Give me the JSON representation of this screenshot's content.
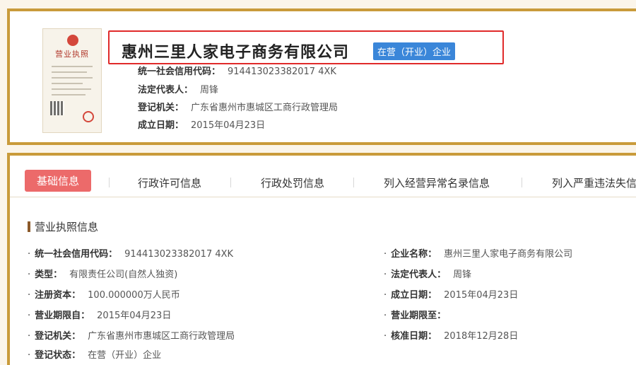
{
  "header": {
    "company_name": "惠州三里人家电子商务有限公司",
    "status_tag": "在营（开业）企业",
    "license_thumb_title": "营业执照",
    "rows": [
      {
        "label": "统一社会信用代码：",
        "value": "914413023382017 4XK"
      },
      {
        "label": "法定代表人：",
        "value": "周锋"
      },
      {
        "label": "登记机关：",
        "value": "广东省惠州市惠城区工商行政管理局"
      },
      {
        "label": "成立日期：",
        "value": "2015年04月23日"
      }
    ]
  },
  "tabs": [
    {
      "label": "基础信息",
      "active": true
    },
    {
      "label": "行政许可信息",
      "active": false
    },
    {
      "label": "行政处罚信息",
      "active": false
    },
    {
      "label": "列入经营异常名录信息",
      "active": false
    },
    {
      "label": "列入严重违法失信",
      "active": false
    }
  ],
  "section": {
    "title": "营业执照信息",
    "left_fields": [
      {
        "label": "统一社会信用代码：",
        "value": "914413023382017 4XK"
      },
      {
        "label": "类型：",
        "value": "有限责任公司(自然人独资)"
      },
      {
        "label": "注册资本：",
        "value": "100.000000万人民币"
      },
      {
        "label": "营业期限自：",
        "value": "2015年04月23日"
      },
      {
        "label": "登记机关：",
        "value": "广东省惠州市惠城区工商行政管理局"
      },
      {
        "label": "登记状态：",
        "value": "在营（开业）企业"
      }
    ],
    "right_fields": [
      {
        "label": "企业名称：",
        "value": "惠州三里人家电子商务有限公司"
      },
      {
        "label": "法定代表人：",
        "value": "周锋"
      },
      {
        "label": "成立日期：",
        "value": "2015年04月23日"
      },
      {
        "label": "营业期限至：",
        "value": ""
      },
      {
        "label": "核准日期：",
        "value": "2018年12月28日"
      }
    ]
  },
  "colors": {
    "accent_border": "#c99b3b",
    "active_tab": "#ec6a6a",
    "status_tag": "#3a86d9",
    "highlight_box": "#e02a2a"
  }
}
